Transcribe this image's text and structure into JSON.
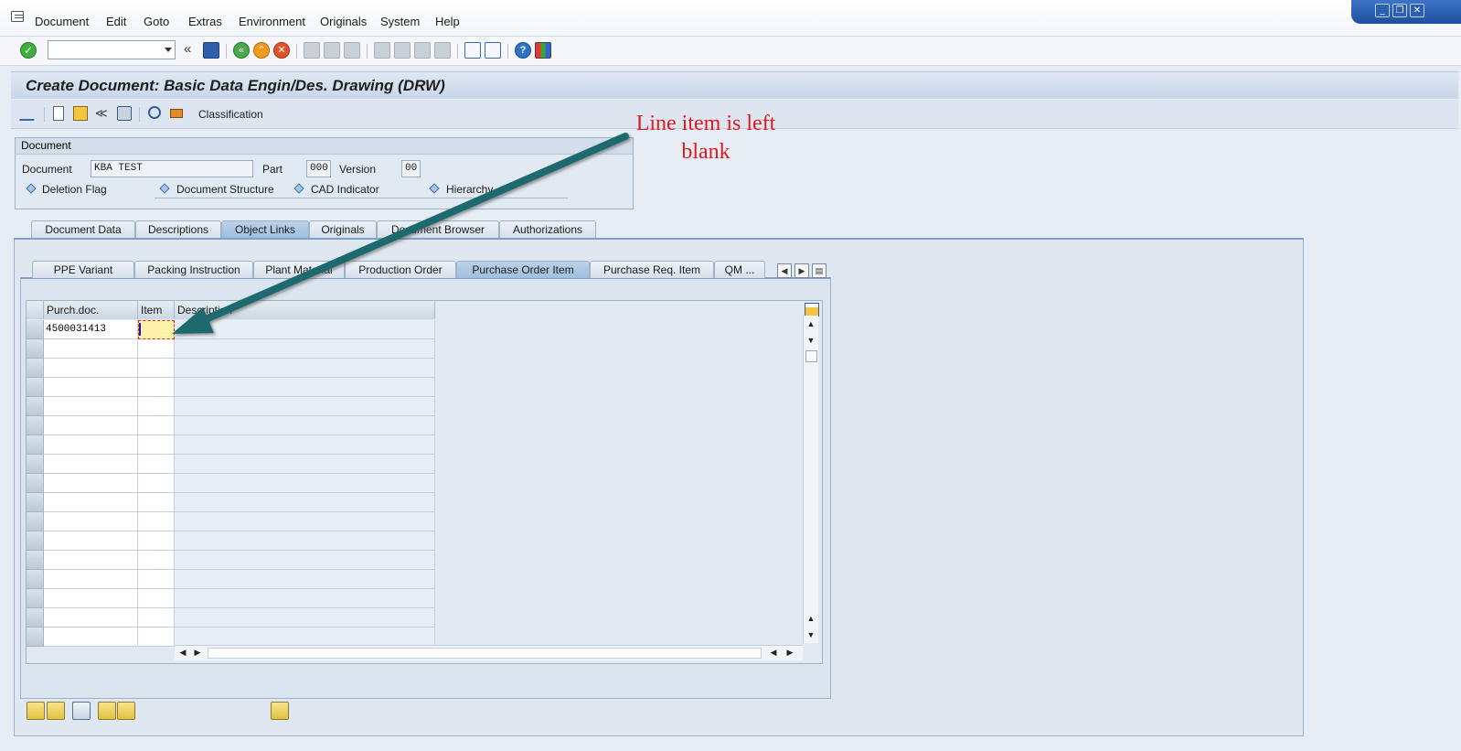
{
  "menu": {
    "items": [
      {
        "label": "Document",
        "left": 0
      },
      {
        "label": "Edit"
      },
      {
        "label": "Goto"
      },
      {
        "label": "Extras"
      },
      {
        "label": "Environment"
      },
      {
        "label": "Originals"
      },
      {
        "label": "System"
      },
      {
        "label": "Help"
      }
    ]
  },
  "window_controls": [
    "minimize-icon",
    "restore-icon",
    "close-icon"
  ],
  "toolbar": {
    "command_field_value": "",
    "icons": [
      "enter-icon",
      "back-double-icon",
      "save-icon",
      "back-icon",
      "exit-icon",
      "cancel-icon",
      "print-icon",
      "find-icon",
      "find-next-icon",
      "first-page-icon",
      "previous-page-icon",
      "next-page-icon",
      "last-page-icon",
      "create-session-icon",
      "shortcut-icon",
      "help-icon",
      "customize-layout-icon"
    ]
  },
  "title": "Create Document: Basic Data Engin/Des. Drawing (DRW)",
  "app_toolbar": {
    "icons": [
      "change-display-icon",
      "new-document-icon",
      "copy-document-icon",
      "hierarchy-icon",
      "find-icon",
      "detail-icon",
      "structure-icon"
    ],
    "classification_label": "Classification"
  },
  "document": {
    "group_title": "Document",
    "document_label": "Document",
    "document_value": "KBA TEST",
    "part_label": "Part",
    "part_value": "000",
    "version_label": "Version",
    "version_value": "00",
    "indicators": [
      "Deletion Flag",
      "Document Structure",
      "CAD Indicator",
      "Hierarchy"
    ]
  },
  "main_tabs": [
    "Document Data",
    "Descriptions",
    "Object Links",
    "Originals",
    "Document Browser",
    "Authorizations"
  ],
  "main_tab_active": "Object Links",
  "object_tabs": [
    "PPE Variant",
    "Packing Instruction",
    "Plant Material",
    "Production Order",
    "Purchase Order Item",
    "Purchase Req. Item",
    "QM ..."
  ],
  "object_tab_active": "Purchase Order Item",
  "table": {
    "columns": [
      "Purch.doc.",
      "Item",
      "Description"
    ],
    "rows": [
      {
        "purch_doc": "4500031413",
        "item": "",
        "description": ""
      }
    ],
    "empty_rows": 16
  },
  "bottom_buttons": [
    "insert-row-icon",
    "detail-view-icon",
    "delete-row-icon",
    "select-all-icon",
    "deselect-all-icon",
    "edit-icon"
  ],
  "annotation": {
    "line1": "Line item is left",
    "line2": "blank",
    "color": "#e01a1a",
    "arrow_color": "#1f6b6e"
  },
  "colors": {
    "title_bar": "#c7d7ea",
    "active_tab": "#9fbedf",
    "focus_cell": "#fff1a8"
  }
}
